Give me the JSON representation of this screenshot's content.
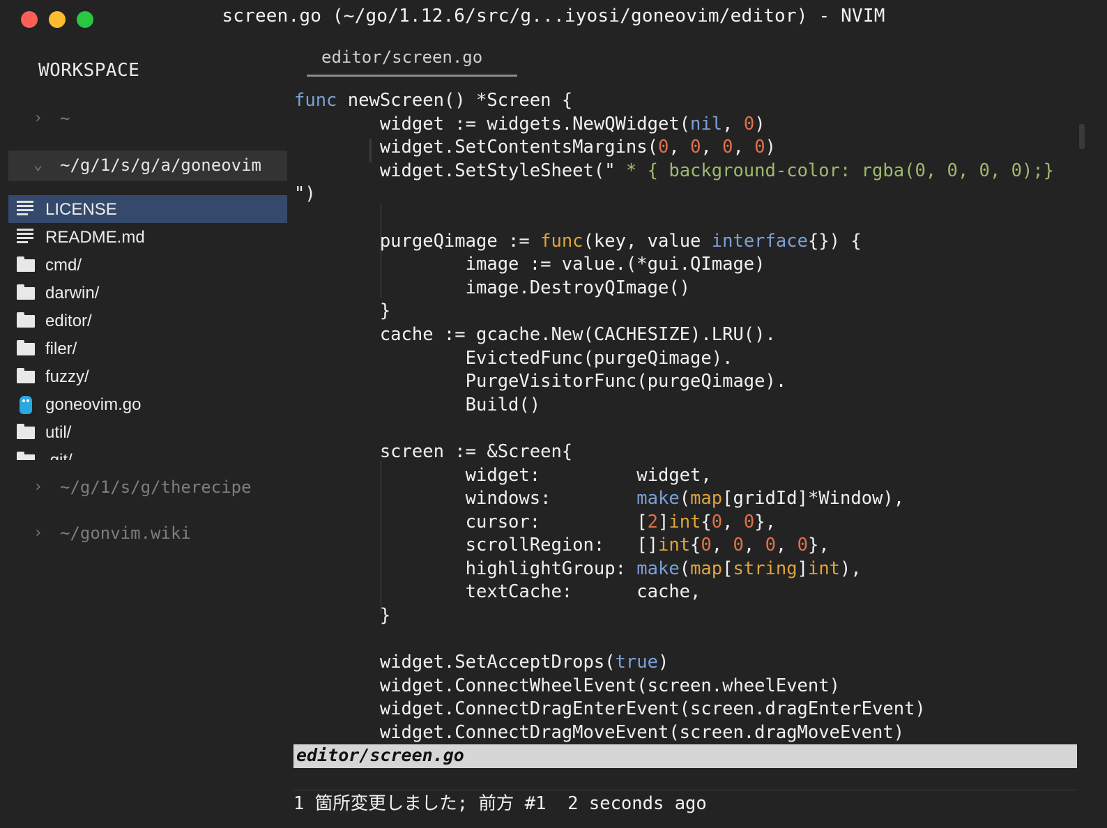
{
  "window": {
    "title": "screen.go (~/go/1.12.6/src/g...iyosi/goneovim/editor) - NVIM"
  },
  "sidebar": {
    "title": "WORKSPACE",
    "workspaces": [
      {
        "chevron": "›",
        "label": "~"
      },
      {
        "chevron": "⌄",
        "label": "~/g/1/s/g/a/goneovim"
      },
      {
        "chevron": "›",
        "label": "~/g/1/s/g/therecipe"
      },
      {
        "chevron": "›",
        "label": "~/gonvim.wiki"
      }
    ],
    "files": [
      {
        "name": "LICENSE",
        "icon": "text-file-icon"
      },
      {
        "name": "README.md",
        "icon": "text-file-icon"
      },
      {
        "name": "cmd/",
        "icon": "folder-icon"
      },
      {
        "name": "darwin/",
        "icon": "folder-icon"
      },
      {
        "name": "editor/",
        "icon": "folder-icon"
      },
      {
        "name": "filer/",
        "icon": "folder-icon"
      },
      {
        "name": "fuzzy/",
        "icon": "folder-icon"
      },
      {
        "name": "goneovim.go",
        "icon": "gopher-icon"
      },
      {
        "name": "util/",
        "icon": "folder-icon"
      },
      {
        "name": ".git/",
        "icon": "folder-icon"
      }
    ]
  },
  "editor": {
    "tab_label": "editor/screen.go",
    "code_lines": [
      [
        [
          "func",
          "kw"
        ],
        [
          " newScreen() *Screen {",
          ""
        ]
      ],
      [
        [
          "        widget := widgets.NewQWidget(",
          ""
        ],
        [
          "nil",
          "kw"
        ],
        [
          ", ",
          ""
        ],
        [
          "0",
          "num"
        ],
        [
          ")",
          ""
        ]
      ],
      [
        [
          "        widget.SetContentsMargins(",
          ""
        ],
        [
          "0",
          "num"
        ],
        [
          ", ",
          ""
        ],
        [
          "0",
          "num"
        ],
        [
          ", ",
          ""
        ],
        [
          "0",
          "num"
        ],
        [
          ", ",
          ""
        ],
        [
          "0",
          "num"
        ],
        [
          ")",
          ""
        ]
      ],
      [
        [
          "        widget.SetStyleSheet(\"",
          ""
        ],
        [
          " * { background-color: rgba(0, 0, 0, 0);}",
          "str"
        ]
      ],
      [
        [
          "\")",
          ""
        ]
      ],
      [
        [
          "",
          ""
        ]
      ],
      [
        [
          "        purgeQimage := ",
          ""
        ],
        [
          "func",
          "fn"
        ],
        [
          "(key, value ",
          ""
        ],
        [
          "interface",
          "kw"
        ],
        [
          "{}) {",
          ""
        ]
      ],
      [
        [
          "                image := value.(*gui.QImage)",
          ""
        ]
      ],
      [
        [
          "                image.DestroyQImage()",
          ""
        ]
      ],
      [
        [
          "        }",
          ""
        ]
      ],
      [
        [
          "        cache := gcache.New(CACHESIZE).LRU().",
          ""
        ]
      ],
      [
        [
          "                EvictedFunc(purgeQimage).",
          ""
        ]
      ],
      [
        [
          "                PurgeVisitorFunc(purgeQimage).",
          ""
        ]
      ],
      [
        [
          "                Build()",
          ""
        ]
      ],
      [
        [
          "",
          ""
        ]
      ],
      [
        [
          "        screen := &Screen{",
          ""
        ]
      ],
      [
        [
          "                widget:         widget,",
          ""
        ]
      ],
      [
        [
          "                windows:        ",
          ""
        ],
        [
          "make",
          "kw"
        ],
        [
          "(",
          ""
        ],
        [
          "map",
          "fn"
        ],
        [
          "[gridId]*Window),",
          ""
        ]
      ],
      [
        [
          "                cursor:         [",
          ""
        ],
        [
          "2",
          "num"
        ],
        [
          "]",
          ""
        ],
        [
          "int",
          "fn"
        ],
        [
          "{",
          ""
        ],
        [
          "0",
          "num"
        ],
        [
          ", ",
          ""
        ],
        [
          "0",
          "num"
        ],
        [
          "},",
          ""
        ]
      ],
      [
        [
          "                scrollRegion:   []",
          ""
        ],
        [
          "int",
          "fn"
        ],
        [
          "{",
          ""
        ],
        [
          "0",
          "num"
        ],
        [
          ", ",
          ""
        ],
        [
          "0",
          "num"
        ],
        [
          ", ",
          ""
        ],
        [
          "0",
          "num"
        ],
        [
          ", ",
          ""
        ],
        [
          "0",
          "num"
        ],
        [
          "},",
          ""
        ]
      ],
      [
        [
          "                highlightGroup: ",
          ""
        ],
        [
          "make",
          "kw"
        ],
        [
          "(",
          ""
        ],
        [
          "map",
          "fn"
        ],
        [
          "[",
          ""
        ],
        [
          "string",
          "fn"
        ],
        [
          "]",
          ""
        ],
        [
          "int",
          "fn"
        ],
        [
          "),",
          ""
        ]
      ],
      [
        [
          "                textCache:      cache,",
          ""
        ]
      ],
      [
        [
          "        }",
          ""
        ]
      ],
      [
        [
          "",
          ""
        ]
      ],
      [
        [
          "        widget.SetAcceptDrops(",
          ""
        ],
        [
          "true",
          "kw"
        ],
        [
          ")",
          ""
        ]
      ],
      [
        [
          "        widget.ConnectWheelEvent(screen.wheelEvent)",
          ""
        ]
      ],
      [
        [
          "        widget.ConnectDragEnterEvent(screen.dragEnterEvent)",
          ""
        ]
      ],
      [
        [
          "        widget.ConnectDragMoveEvent(screen.dragMoveEvent)",
          ""
        ]
      ]
    ],
    "statusline": "editor/screen.go",
    "cmdline": "1 箇所変更しました; 前方 #1  2 seconds ago"
  },
  "colors": {
    "keyword": "#7ba0d6",
    "number": "#e0714a",
    "string": "#9fb86e",
    "builtin": "#e1a33b",
    "selection": "#34496b"
  }
}
